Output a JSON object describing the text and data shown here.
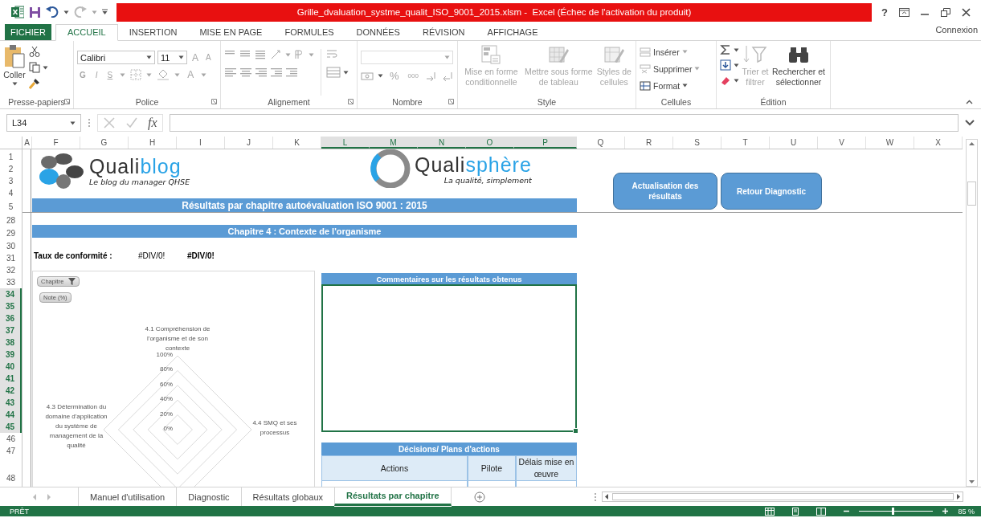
{
  "window": {
    "title": "Grille_dvaluation_systme_qualit_ISO_9001_2015.xlsm -  Excel (Échec de l'activation du produit)",
    "help": "?"
  },
  "ribbon_tabs": [
    {
      "label": "FICHIER",
      "kind": "file",
      "selected": false
    },
    {
      "label": "ACCUEIL",
      "kind": "tab",
      "selected": true
    },
    {
      "label": "INSERTION",
      "kind": "tab",
      "selected": false
    },
    {
      "label": "MISE EN PAGE",
      "kind": "tab",
      "selected": false
    },
    {
      "label": "FORMULES",
      "kind": "tab",
      "selected": false
    },
    {
      "label": "DONNÉES",
      "kind": "tab",
      "selected": false
    },
    {
      "label": "RÉVISION",
      "kind": "tab",
      "selected": false
    },
    {
      "label": "AFFICHAGE",
      "kind": "tab",
      "selected": false
    }
  ],
  "account": "Connexion",
  "clipboard": {
    "label": "Presse-papiers",
    "paste": "Coller"
  },
  "font": {
    "label": "Police",
    "name": "Calibri",
    "size": "11",
    "grow": "A",
    "shrink": "A",
    "bold": "G",
    "italic": "I",
    "underline": "S",
    "font_color_button": "A",
    "disabled": true
  },
  "alignment": {
    "label": "Alignement",
    "disabled": true
  },
  "number": {
    "label": "Nombre",
    "percent": "%",
    "thousands": "000",
    "disabled": true
  },
  "styles": {
    "label": "Style",
    "buttons": [
      {
        "label": "Mise en forme conditionnelle",
        "kind": "conditional",
        "disabled": true
      },
      {
        "label": "Mettre sous forme de tableau",
        "kind": "table",
        "disabled": true
      },
      {
        "label": "Styles de cellules",
        "kind": "cellstyles",
        "disabled": true
      }
    ]
  },
  "cells": {
    "label": "Cellules",
    "buttons": [
      {
        "label": "Insérer",
        "kind": "insert",
        "disabled": true
      },
      {
        "label": "Supprimer",
        "kind": "delete",
        "disabled": true
      },
      {
        "label": "Format",
        "kind": "format",
        "disabled": false
      }
    ]
  },
  "editing": {
    "label": "Édition",
    "buttons": [
      {
        "label": "Trier et filtrer",
        "kind": "sort",
        "disabled": true
      },
      {
        "label": "Rechercher et sélectionner",
        "kind": "find",
        "disabled": false
      }
    ]
  },
  "formula_bar": {
    "name_box": "L34",
    "fx": "fx"
  },
  "columns": [
    {
      "label": "A",
      "selected": false
    },
    {
      "label": "F",
      "selected": false
    },
    {
      "label": "G",
      "selected": false
    },
    {
      "label": "H",
      "selected": false
    },
    {
      "label": "I",
      "selected": false
    },
    {
      "label": "J",
      "selected": false
    },
    {
      "label": "K",
      "selected": false
    },
    {
      "label": "L",
      "selected": true
    },
    {
      "label": "M",
      "selected": true
    },
    {
      "label": "N",
      "selected": true
    },
    {
      "label": "O",
      "selected": true
    },
    {
      "label": "P",
      "selected": true
    },
    {
      "label": "Q",
      "selected": false
    },
    {
      "label": "R",
      "selected": false
    },
    {
      "label": "S",
      "selected": false
    },
    {
      "label": "T",
      "selected": false
    },
    {
      "label": "U",
      "selected": false
    },
    {
      "label": "V",
      "selected": false
    },
    {
      "label": "W",
      "selected": false
    },
    {
      "label": "X",
      "selected": false
    }
  ],
  "rows": [
    {
      "label": "1",
      "selected": false
    },
    {
      "label": "2",
      "selected": false
    },
    {
      "label": "3",
      "selected": false
    },
    {
      "label": "4",
      "selected": false
    },
    {
      "label": "5",
      "selected": false
    },
    {
      "label": "28",
      "selected": false
    },
    {
      "label": "29",
      "selected": false
    },
    {
      "label": "30",
      "selected": false
    },
    {
      "label": "31",
      "selected": false
    },
    {
      "label": "32",
      "selected": false
    },
    {
      "label": "33",
      "selected": false
    },
    {
      "label": "34",
      "selected": true
    },
    {
      "label": "35",
      "selected": true
    },
    {
      "label": "36",
      "selected": true
    },
    {
      "label": "37",
      "selected": true
    },
    {
      "label": "38",
      "selected": true
    },
    {
      "label": "39",
      "selected": true
    },
    {
      "label": "40",
      "selected": true
    },
    {
      "label": "41",
      "selected": true
    },
    {
      "label": "42",
      "selected": true
    },
    {
      "label": "43",
      "selected": true
    },
    {
      "label": "44",
      "selected": true
    },
    {
      "label": "45",
      "selected": true
    },
    {
      "label": "46",
      "selected": false
    },
    {
      "label": "47",
      "selected": false
    },
    {
      "label": "48",
      "selected": false
    }
  ],
  "logos": [
    {
      "prefix": "Quali",
      "suffix": "blog",
      "tagline": "Le blog du manager QHSE",
      "kind": "petals"
    },
    {
      "prefix": "Quali",
      "suffix": "sphère",
      "tagline": "La qualité, simplement",
      "kind": "ring"
    }
  ],
  "title_banner": "Résultats par chapitre autoévaluation ISO 9001 : 2015",
  "buttons": [
    "Actualisation des résultats",
    "Retour Diagnostic"
  ],
  "chapter_banner": "Chapitre 4 : Contexte de l'organisme",
  "conformity": {
    "label": "Taux de conformité :",
    "values": [
      "#DIV/0!",
      "#DIV/0!"
    ]
  },
  "radar_chart": {
    "fields": [
      {
        "label": "Chapitre",
        "filter": true
      },
      {
        "label": "Note (%)",
        "filter": false
      }
    ],
    "axes": [
      "4.1 Compréhension de l'organisme et de son contexte",
      "4.3 Détermination du domaine d'application du système de management de la qualité",
      "4.4 SMQ et ses processus"
    ],
    "ticks": [
      "100%",
      "80%",
      "60%",
      "40%",
      "20%",
      "0%"
    ]
  },
  "comments": {
    "title": "Commentaires sur les résultats obtenus",
    "selected": true
  },
  "actions_table": {
    "title": "Décisions/ Plans d'actions",
    "columns": [
      "Actions",
      "Pilote",
      "Délais mise en œuvre"
    ]
  },
  "sheet_tabs": [
    {
      "label": "Manuel d'utilisation",
      "selected": false
    },
    {
      "label": "Diagnostic",
      "selected": false
    },
    {
      "label": "Résultats globaux",
      "selected": false
    },
    {
      "label": "Résultats par chapitre",
      "selected": true
    }
  ],
  "status": {
    "mode": "PRÊT",
    "zoom": "85 %"
  },
  "zoom_slider": {
    "level": 0.45
  }
}
